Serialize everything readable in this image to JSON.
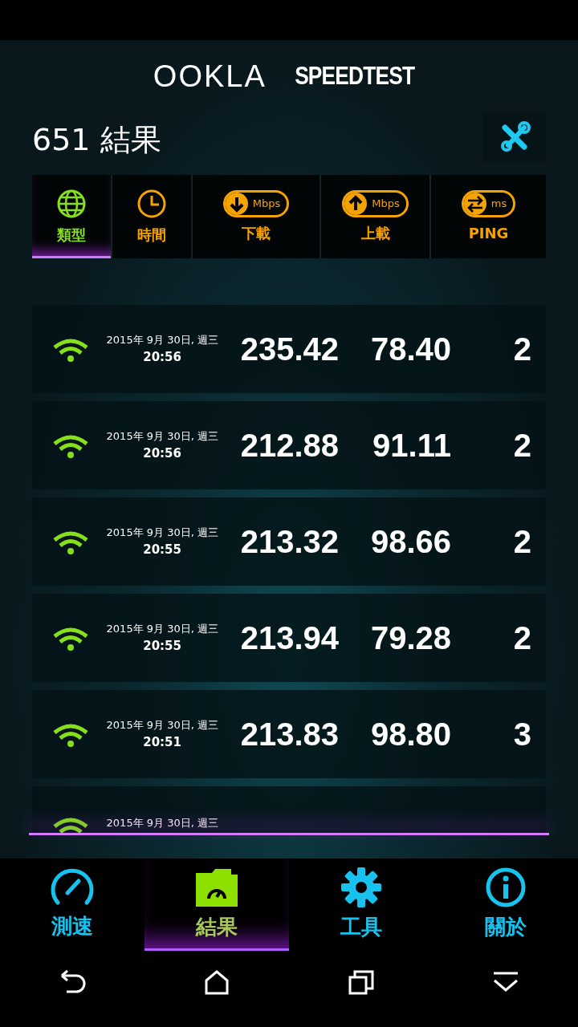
{
  "header": {
    "logo": "OOKLA",
    "title": "SPEEDTEST"
  },
  "results": {
    "title": "651 結果"
  },
  "sort_columns": [
    {
      "kind": "type",
      "label": "類型",
      "selected": true
    },
    {
      "kind": "time",
      "label": "時間",
      "selected": false
    },
    {
      "kind": "download",
      "label": "下載",
      "unit": "Mbps",
      "selected": false
    },
    {
      "kind": "upload",
      "label": "上載",
      "unit": "Mbps",
      "selected": false
    },
    {
      "kind": "ping",
      "label": "PING",
      "unit": "ms",
      "selected": false
    }
  ],
  "rows": [
    {
      "date": "2015年 9月 30日, 週三",
      "time": "20:56",
      "download": "235.42",
      "upload": "78.40",
      "ping": "2"
    },
    {
      "date": "2015年 9月 30日, 週三",
      "time": "20:56",
      "download": "212.88",
      "upload": "91.11",
      "ping": "2"
    },
    {
      "date": "2015年 9月 30日, 週三",
      "time": "20:55",
      "download": "213.32",
      "upload": "98.66",
      "ping": "2"
    },
    {
      "date": "2015年 9月 30日, 週三",
      "time": "20:55",
      "download": "213.94",
      "upload": "79.28",
      "ping": "2"
    },
    {
      "date": "2015年 9月 30日, 週三",
      "time": "20:51",
      "download": "213.83",
      "upload": "98.80",
      "ping": "3"
    },
    {
      "date": "2015年 9月 30日, 週三"
    }
  ],
  "tabs": [
    {
      "kind": "speed",
      "label": "測速",
      "selected": false
    },
    {
      "kind": "results",
      "label": "結果",
      "selected": true
    },
    {
      "kind": "tools",
      "label": "工具",
      "selected": false
    },
    {
      "kind": "about",
      "label": "關於",
      "selected": false
    }
  ]
}
